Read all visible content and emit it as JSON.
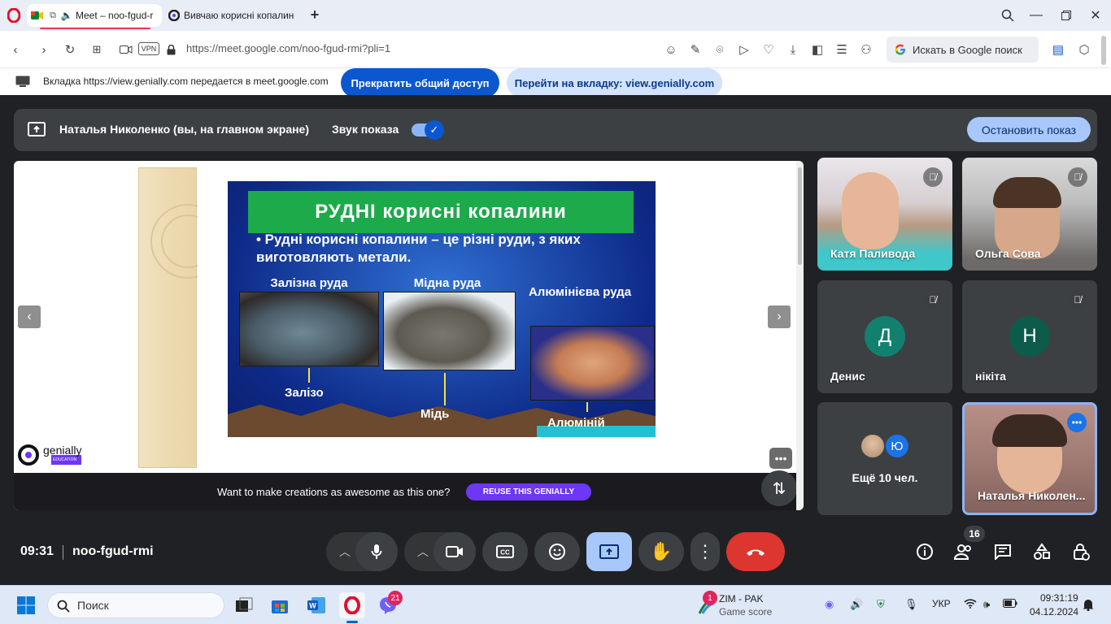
{
  "browser": {
    "tabs": [
      {
        "label": "Meet – noo-fgud-r",
        "active": true
      },
      {
        "label": "Вивчаю корисні копалин",
        "active": false
      }
    ],
    "new_tab_symbol": "+",
    "url": "https://meet.google.com/noo-fgud-rmi?pli=1",
    "vpn_label": "VPN",
    "search_placeholder": "Искать в Google поиск"
  },
  "share_banner": {
    "text": "Вкладка https://view.genially.com передается в meet.google.com",
    "stop_button": "Прекратить общий доступ",
    "goto_button": "Перейти на вкладку: view.genially.com"
  },
  "meet": {
    "presenting_text": "Наталья Николенко (вы, на главном экране)",
    "sound_label": "Звук показа",
    "sound_enabled": true,
    "stop_show_button": "Остановить показ",
    "time": "09:31",
    "meeting_code": "noo-fgud-rmi",
    "people_count": "16"
  },
  "slide": {
    "title": "РУДНІ корисні копалини",
    "bullet": "• Рудні корисні копалини – це різні руди, з яких виготовляють метали.",
    "ores": [
      {
        "label": "Залізна руда",
        "metal": "Залізо"
      },
      {
        "label": "Мідна руда",
        "metal": "Мідь"
      },
      {
        "label": "Алюмінієва руда",
        "metal": "Алюміній"
      }
    ]
  },
  "genially": {
    "logo_text": "genially",
    "logo_sub": "EDUCATION",
    "cta_text": "Want to make creations as awesome as this one?",
    "reuse_button": "REUSE THIS GENIALLY"
  },
  "participants": [
    {
      "name": "Катя Паливода",
      "type": "video",
      "muted": true
    },
    {
      "name": "Ольга Сова",
      "type": "video",
      "muted": true
    },
    {
      "name": "Денис",
      "type": "avatar",
      "initial": "Д",
      "color": "#12806e",
      "muted": true
    },
    {
      "name": "нікіта",
      "type": "avatar",
      "initial": "Н",
      "color": "#0d5b4a",
      "muted": true
    },
    {
      "name": "Ещё 10 чел.",
      "type": "more",
      "initial": "Ю",
      "color": "#1a73e8"
    },
    {
      "name": "Наталья Николен...",
      "type": "video",
      "self": true
    }
  ],
  "taskbar": {
    "search_label": "Поиск",
    "viber_badge": "21",
    "news_badge": "1",
    "news_title": "ZIM - PAK",
    "news_sub": "Game score",
    "lang": "УКР",
    "time": "09:31:19",
    "date": "04.12.2024"
  },
  "colors": {
    "accent": "#0b57d0",
    "meet_bg": "#202124",
    "end_call": "#dc362e",
    "present_active": "#a8c7fa"
  }
}
